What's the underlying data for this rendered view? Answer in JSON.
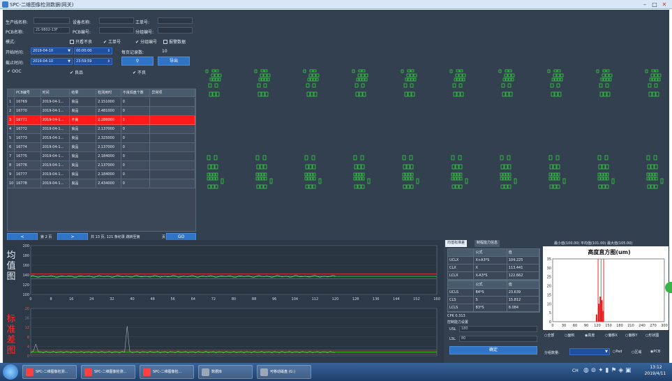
{
  "window": {
    "title": "SPC-二维图像检测数据(网关)",
    "min": "–",
    "max": "□",
    "close": "✕"
  },
  "filters": {
    "station_label": "生产线名称:",
    "station_value": "",
    "device_label": "设备名称:",
    "device_value": "",
    "worker_label": "工单号:",
    "worker_value": "",
    "pcb_label": "PCB名称:",
    "pcb_value": "21-9802-13F",
    "panel_label": "PCB编号:",
    "panel_value": "",
    "batch_label": "分组编号:",
    "batch_value": "",
    "mode_label": "模式:",
    "chk_ng_label": "只看不良",
    "chk_ng": false,
    "chk_order_label": "工单号",
    "chk_order": true,
    "chk_group_label": "分组编号",
    "chk_group": true,
    "chk_alarm_label": "报警数据",
    "chk_alarm": false,
    "start_label": "开始时间:",
    "start_date": "2019-04-10",
    "start_time": "00:00:00",
    "end_label": "截止时间:",
    "end_date": "2019-04-10",
    "end_time": "23:59:59",
    "pagesize_label": "每页记录数:",
    "pagesize_value": "10",
    "query_icon": "search-icon",
    "export_label": "导出",
    "chk_ooc_label": "OOC",
    "chk_ooc": true,
    "chk_ok_label": "良品",
    "chk_ok": true,
    "chk_fail_label": "不良",
    "chk_fail": true
  },
  "table": {
    "headers": [
      "",
      "PCB编号",
      "时间",
      "结果",
      "检测用时",
      "不良焊盘个数",
      "异常项"
    ],
    "rows": [
      {
        "n": "1",
        "pcb": "16769",
        "time": "2019-04-1…",
        "result": "良品",
        "dur": "2.151000",
        "bad": "0",
        "abn": ""
      },
      {
        "n": "2",
        "pcb": "16770",
        "time": "2019-04-1…",
        "result": "良品",
        "dur": "2.481000",
        "bad": "0",
        "abn": ""
      },
      {
        "n": "3",
        "pcb": "16771",
        "time": "2019-04-1…",
        "result": "不良",
        "dur": "2.286000",
        "bad": "1",
        "abn": ""
      },
      {
        "n": "4",
        "pcb": "16772",
        "time": "2019-04-1…",
        "result": "良品",
        "dur": "2.137000",
        "bad": "0",
        "abn": ""
      },
      {
        "n": "5",
        "pcb": "16773",
        "time": "2019-04-1…",
        "result": "良品",
        "dur": "2.325000",
        "bad": "0",
        "abn": ""
      },
      {
        "n": "6",
        "pcb": "16774",
        "time": "2019-04-1…",
        "result": "良品",
        "dur": "2.137000",
        "bad": "0",
        "abn": ""
      },
      {
        "n": "7",
        "pcb": "16775",
        "time": "2019-04-1…",
        "result": "良品",
        "dur": "2.184000",
        "bad": "0",
        "abn": ""
      },
      {
        "n": "8",
        "pcb": "16776",
        "time": "2019-04-1…",
        "result": "良品",
        "dur": "2.137000",
        "bad": "0",
        "abn": ""
      },
      {
        "n": "9",
        "pcb": "16777",
        "time": "2019-04-1…",
        "result": "良品",
        "dur": "2.184000",
        "bad": "0",
        "abn": ""
      },
      {
        "n": "10",
        "pcb": "16778",
        "time": "2019-04-1…",
        "result": "良品",
        "dur": "2.434000",
        "bad": "0",
        "abn": ""
      }
    ],
    "bad_row_color": "#ff1a1a"
  },
  "pager": {
    "prev": "<",
    "page_label": "第 2 页",
    "next": ">",
    "summary": "共 13 页, 121 条纪录 跳转至第",
    "jump_value": "页",
    "go": "GO"
  },
  "mean_chart": {
    "label": [
      "均",
      "值",
      "图"
    ],
    "y_ticks": [
      "200",
      "180",
      "160",
      "140",
      "120",
      "100"
    ],
    "x_ticks": [
      "0",
      "8",
      "16",
      "24",
      "32",
      "40",
      "48",
      "56",
      "64",
      "72",
      "80",
      "88",
      "96",
      "104",
      "112",
      "120",
      "128",
      "136",
      "144",
      "152",
      "160"
    ],
    "ucl_color": "#ff3030",
    "cl_color": "#30e030"
  },
  "std_chart": {
    "label": [
      "标",
      "准",
      "差",
      "图"
    ],
    "label_color": "#ff2d2d",
    "y_ticks": [
      "20",
      "16",
      "12",
      "8",
      "4",
      "0"
    ]
  },
  "stats": {
    "tab_active": "均值标准差",
    "tab_other": "制程能力信息",
    "mean_header": [
      "",
      "公式",
      "值"
    ],
    "mean_rows": [
      [
        "UCLX",
        "X+A3*S",
        "104.225"
      ],
      [
        "CLX",
        "X",
        "113.441"
      ],
      [
        "LCLX",
        "X-A3*S",
        "122.662"
      ]
    ],
    "std_header": [
      "",
      "公式",
      "值"
    ],
    "std_rows": [
      [
        "UCLS",
        "B4*S",
        "23.639"
      ],
      [
        "CLS",
        "S",
        "15.812"
      ],
      [
        "LCLS",
        "B3*S",
        "8.084"
      ]
    ],
    "cpk_label": "CPK 0.313",
    "limit_title": "控制能力设置",
    "usl_label": "USL",
    "usl_value": "180",
    "lsl_label": "LSL",
    "lsl_value": "80",
    "confirm": "确定"
  },
  "hist": {
    "info": "最小值(100.00) 平均值(101.00) 最大值(105.00)",
    "title": "高度直方图(um)",
    "y_ticks": [
      "35",
      "30",
      "25",
      "20",
      "15",
      "10",
      "5",
      "0"
    ],
    "x_ticks": [
      "0",
      "30",
      "60",
      "90",
      "120",
      "150",
      "180",
      "210",
      "240",
      "270",
      "300"
    ],
    "radios": [
      {
        "label": "全部",
        "on": false
      },
      {
        "label": "面积",
        "on": false
      },
      {
        "label": "高度",
        "on": true
      },
      {
        "label": "偏移X",
        "on": false
      },
      {
        "label": "偏移Y",
        "on": false
      },
      {
        "label": "形状图",
        "on": false
      }
    ],
    "group_label": "分组数量:",
    "group_value": "",
    "radios2": [
      {
        "label": "Pad",
        "on": false
      },
      {
        "label": "区域",
        "on": false
      },
      {
        "label": "PCB",
        "on": true
      }
    ]
  },
  "taskbar": {
    "tasks": [
      {
        "label": "SPC-二维图像检测...",
        "color": "#ff4040"
      },
      {
        "label": "SPC-二维图像检测...",
        "color": "#ff4040"
      },
      {
        "label": "SPC-二维图像检...",
        "color": "#ff4040"
      },
      {
        "label": "数据库",
        "color": "#9aa8b8"
      },
      {
        "label": "可移动磁盘 (G:)",
        "color": "#9aa8b8"
      }
    ],
    "lang": "CH",
    "time": "13:12",
    "date": "2019/4/11"
  }
}
